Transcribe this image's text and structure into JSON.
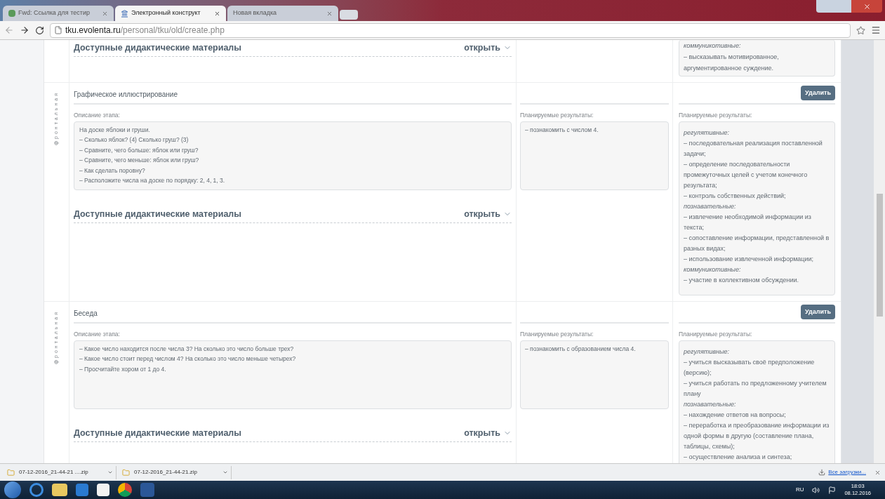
{
  "tabs": [
    {
      "title": "Fwd: Ссылка для тестир",
      "selected": false
    },
    {
      "title": "Электронный конструкт",
      "selected": true
    },
    {
      "title": "Новая вкладка",
      "selected": false
    }
  ],
  "address": {
    "host": "tku.evolenta.ru",
    "path": "/personal/tku/old/create.php"
  },
  "stages": [
    {
      "materials": "Доступные дидактические материалы",
      "open": "открыть",
      "results": [
        {
          "kind": "category",
          "text": "коммуникотивные:"
        },
        {
          "kind": "item",
          "text": "– высказывать мотивированное, аргументированное суждение."
        }
      ]
    },
    {
      "form": "фронтальная",
      "title": "Графическое иллюстрирование",
      "delete": "Удалить",
      "description_label": "Описание этапа:",
      "description": [
        "На доске яблоки и груши.",
        "– Сколько яблок? (4) Сколько груш? (3)",
        "– Сравните, чего больше: яблок или груш?",
        "– Сравните, чего меньше: яблок или груш?",
        "– Как сделать поровну?",
        "– Расположите числа на доске по порядку: 2, 4, 1, 3."
      ],
      "planned_label": "Планируемые результаты:",
      "planned": [
        "– познакомить с числом 4."
      ],
      "results_label": "Планируемые результаты:",
      "results": [
        {
          "kind": "category",
          "text": "регулятивные:"
        },
        {
          "kind": "item",
          "text": "– последовательная реализация поставленной задачи;"
        },
        {
          "kind": "item",
          "text": "– определение последовательности промежуточных целей с учетом конечного результата;"
        },
        {
          "kind": "item",
          "text": "– контроль собственных действий;"
        },
        {
          "kind": "category",
          "text": "познавательные:"
        },
        {
          "kind": "item",
          "text": "– извлечение необходимой информации из текста;"
        },
        {
          "kind": "item",
          "text": "– сопоставление информации, представленной в разных видах;"
        },
        {
          "kind": "item",
          "text": "– использование извлеченной информации;"
        },
        {
          "kind": "category",
          "text": "коммуникотивные:"
        },
        {
          "kind": "item",
          "text": "– участие в коллективном обсуждении."
        }
      ],
      "materials": "Доступные дидактические материалы",
      "open": "открыть"
    },
    {
      "form": "фронтальная",
      "title": "Беседа",
      "delete": "Удалить",
      "description_label": "Описание этапа:",
      "description": [
        "– Какое число находится после числа 3? На сколько это число больше трех?",
        "– Какое число стоит перед числом 4? На сколько это число меньше четырех?",
        "– Просчитайте хором от 1 до 4."
      ],
      "planned_label": "Планируемые результаты:",
      "planned": [
        "– познакомить с образованием числа 4."
      ],
      "results_label": "Планируемые результаты:",
      "results": [
        {
          "kind": "category",
          "text": "регулятивные:"
        },
        {
          "kind": "item",
          "text": "– учиться высказывать своё предположение (версию);"
        },
        {
          "kind": "item",
          "text": "– учиться работать по предложенному учителем плану"
        },
        {
          "kind": "category",
          "text": "познавательные:"
        },
        {
          "kind": "item",
          "text": "– нахождение ответов на вопросы;"
        },
        {
          "kind": "item",
          "text": "– переработка и преобразование информации из одной формы в другую (составление плана, таблицы, схемы);"
        },
        {
          "kind": "item",
          "text": "– осуществление анализа и синтеза;"
        }
      ],
      "materials": "Доступные дидактические материалы",
      "open": "открыть"
    }
  ],
  "downloads": [
    {
      "name": "07-12-2016_21-44-21 ....zip"
    },
    {
      "name": "07-12-2016_21-44-21.zip"
    }
  ],
  "downloads_link": "Все загрузки...",
  "tray": {
    "language": "RU",
    "time": "18:03",
    "date": "08.12.2016"
  }
}
